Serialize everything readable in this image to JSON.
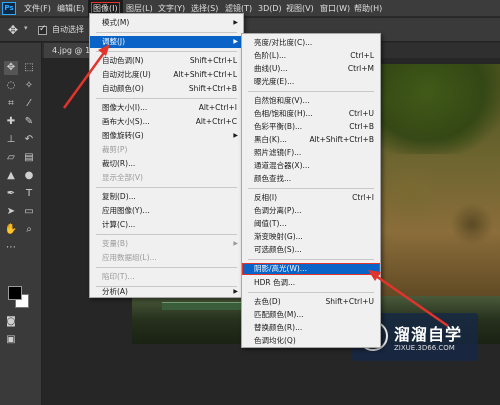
{
  "app": {
    "logo": "Ps"
  },
  "menubar": {
    "file": "文件(F)",
    "edit": "编辑(E)",
    "image": "图像(I)",
    "layer": "图层(L)",
    "type": "文字(Y)",
    "select": "选择(S)",
    "filter": "滤镜(T)",
    "3d": "3D(D)",
    "view": "视图(V)",
    "window": "窗口(W)",
    "help": "帮助(H)"
  },
  "options": {
    "auto_select": "自动选择"
  },
  "document_tab": {
    "label": "4.jpg @ 10"
  },
  "image_menu": {
    "mode": "模式(M)",
    "adjust": "调整(J)",
    "auto_tone": "自动色调(N)",
    "auto_tone_sc": "Shift+Ctrl+L",
    "auto_contrast": "自动对比度(U)",
    "auto_contrast_sc": "Alt+Shift+Ctrl+L",
    "auto_color": "自动颜色(O)",
    "auto_color_sc": "Shift+Ctrl+B",
    "image_size": "图像大小(I)...",
    "image_size_sc": "Alt+Ctrl+I",
    "canvas_size": "画布大小(S)...",
    "canvas_size_sc": "Alt+Ctrl+C",
    "rotation": "图像旋转(G)",
    "crop": "裁剪(P)",
    "trim": "裁切(R)...",
    "reveal_all": "显示全部(V)",
    "duplicate": "复制(D)...",
    "apply_image": "应用图像(Y)...",
    "calculations": "计算(C)...",
    "variables": "变量(B)",
    "apply_data": "应用数据组(L)...",
    "trap": "陷印(T)...",
    "analysis": "分析(A)"
  },
  "adjust_menu": {
    "brightness_contrast": "亮度/对比度(C)...",
    "levels": "色阶(L)...",
    "levels_sc": "Ctrl+L",
    "curves": "曲线(U)...",
    "curves_sc": "Ctrl+M",
    "exposure": "曝光度(E)...",
    "vibrance": "自然饱和度(V)...",
    "hue_sat": "色相/饱和度(H)...",
    "hue_sat_sc": "Ctrl+U",
    "color_balance": "色彩平衡(B)...",
    "color_balance_sc": "Ctrl+B",
    "black_white": "黑白(K)...",
    "black_white_sc": "Alt+Shift+Ctrl+B",
    "photo_filter": "照片滤镜(F)...",
    "channel_mixer": "通道混合器(X)...",
    "color_lookup": "颜色查找...",
    "invert": "反相(I)",
    "invert_sc": "Ctrl+I",
    "posterize": "色调分离(P)...",
    "threshold": "阈值(T)...",
    "gradient_map": "渐变映射(G)...",
    "selective_color": "可选颜色(S)...",
    "shadows_highlights": "阴影/高光(W)...",
    "hdr_toning": "HDR 色调...",
    "desaturate": "去色(D)",
    "desaturate_sc": "Shift+Ctrl+U",
    "match_color": "匹配颜色(M)...",
    "replace_color": "替换颜色(R)...",
    "equalize": "色调均化(Q)"
  },
  "watermark": {
    "title": "溜溜自学",
    "url": "ZIXUE.3D66.COM"
  },
  "colors": {
    "menu_highlight": "#0a64c8",
    "annotation_red": "#e0342d",
    "ps_blue": "#31a8ff"
  }
}
